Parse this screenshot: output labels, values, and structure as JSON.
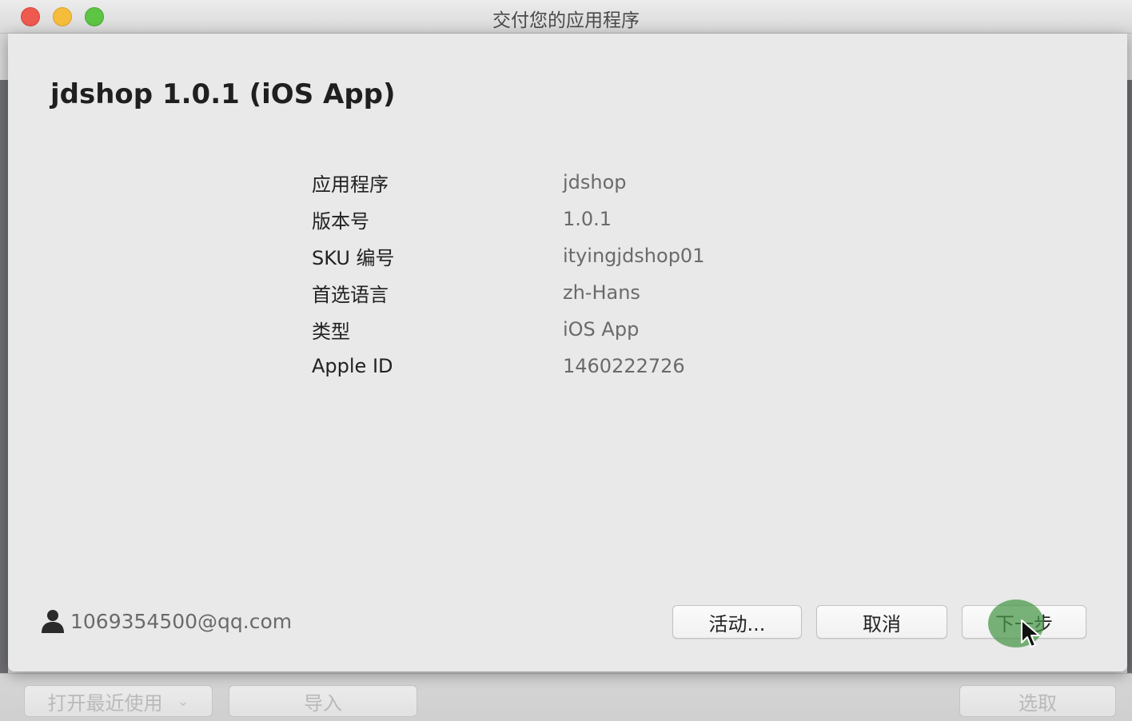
{
  "window": {
    "title": "交付您的应用程序"
  },
  "app": {
    "heading": "jdshop 1.0.1 (iOS App)"
  },
  "info_rows": [
    {
      "label": "应用程序",
      "value": "jdshop"
    },
    {
      "label": "版本号",
      "value": "1.0.1"
    },
    {
      "label": "SKU 编号",
      "value": "ityingjdshop01"
    },
    {
      "label": "首选语言",
      "value": "zh-Hans"
    },
    {
      "label": "类型",
      "value": "iOS App"
    },
    {
      "label": "Apple ID",
      "value": "1460222726"
    }
  ],
  "account": {
    "email": "1069354500@qq.com",
    "icon": "person-icon"
  },
  "buttons": {
    "activity": "活动...",
    "cancel": "取消",
    "next": "下一步"
  },
  "background_toolbar": {
    "open_recent": "打开最近使用",
    "import": "导入",
    "choose": "选取"
  },
  "colors": {
    "close": "#ee5a50",
    "minimize": "#f5bd3b",
    "maximize": "#5ec443",
    "click_highlight": "#4a964a"
  }
}
